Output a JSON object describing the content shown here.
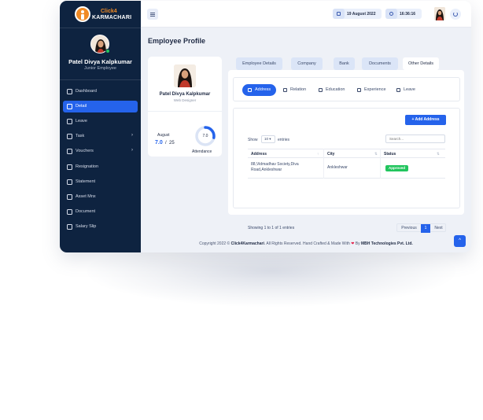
{
  "brand": {
    "logo_top": "Click4",
    "logo_bottom": "KARMACHARI"
  },
  "sidebar": {
    "user_name": "Patel Divya Kalpkumar",
    "user_role": "Junior Employee",
    "items": [
      {
        "label": "Dashboard",
        "icon": "home-icon"
      },
      {
        "label": "Detail",
        "icon": "users-icon",
        "active": true
      },
      {
        "label": "Leave",
        "icon": "user-minus-icon"
      },
      {
        "label": "Task",
        "icon": "clipboard-icon",
        "chevron": "›"
      },
      {
        "label": "Vouchers",
        "icon": "bookmark-icon",
        "chevron": "›"
      },
      {
        "label": "Resignation",
        "icon": "pen-icon"
      },
      {
        "label": "Statement",
        "icon": "tablet-icon"
      },
      {
        "label": "Asset Mnx",
        "icon": "layers-icon"
      },
      {
        "label": "Document",
        "icon": "file-icon"
      },
      {
        "label": "Salary Slip",
        "icon": "book-icon"
      }
    ]
  },
  "topbar": {
    "date": "19 August 2022",
    "time": "16:36:16"
  },
  "page": {
    "title": "Employee Profile"
  },
  "profile_card": {
    "name": "Patel Divya Kalpkumar",
    "role": "Web Designer",
    "attendance_month": "August",
    "attendance_value": "7.0",
    "attendance_sep": "/",
    "attendance_total": "25",
    "ring_value": "7.0",
    "ring_fraction": 0.28,
    "attendance_label": "Attendance"
  },
  "tabs": [
    {
      "label": "Employee Details"
    },
    {
      "label": "Company"
    },
    {
      "label": "Bank"
    },
    {
      "label": "Documents"
    },
    {
      "label": "Other Details",
      "active": true
    }
  ],
  "subtabs": [
    {
      "label": "Address",
      "icon": "address-card-icon",
      "active": true
    },
    {
      "label": "Relation",
      "icon": "users-icon"
    },
    {
      "label": "Education",
      "icon": "graduation-cap-icon"
    },
    {
      "label": "Experience",
      "icon": "briefcase-icon"
    },
    {
      "label": "Leave",
      "icon": "hourglass-icon"
    }
  ],
  "table_controls": {
    "add_label": "+ Add Address",
    "show_label": "Show",
    "page_size": "10 ▾",
    "entries_label": "entries",
    "search_placeholder": "Search..."
  },
  "table": {
    "headers": [
      "Address",
      "City",
      "Status"
    ],
    "sort_icons": [
      "↑",
      "⇅",
      "⇅"
    ],
    "rows": [
      {
        "address_line1": "88,Vidmadhav Society,Diva",
        "address_line2": "Road,Ankleshwar",
        "city": "Ankleshwar",
        "status": "Approved"
      }
    ]
  },
  "pagination": {
    "info": "Showing 1 to 1 of 1 entries",
    "previous": "Previous",
    "current": "1",
    "next": "Next"
  },
  "footer": {
    "copyright": "Copyright 2022 ©",
    "brand": "Click4Karmachari",
    "rights": ". All Rights Reserved. Hand Crafted & Made With",
    "heart": "❤",
    "by": "By",
    "company": "MBH Technologies Pvt. Ltd."
  },
  "scroll_top_icon": "^",
  "colors": {
    "sidebar": "#0e2340",
    "accent": "#2563eb",
    "brand_orange": "#f08a24",
    "success": "#22c55e"
  }
}
